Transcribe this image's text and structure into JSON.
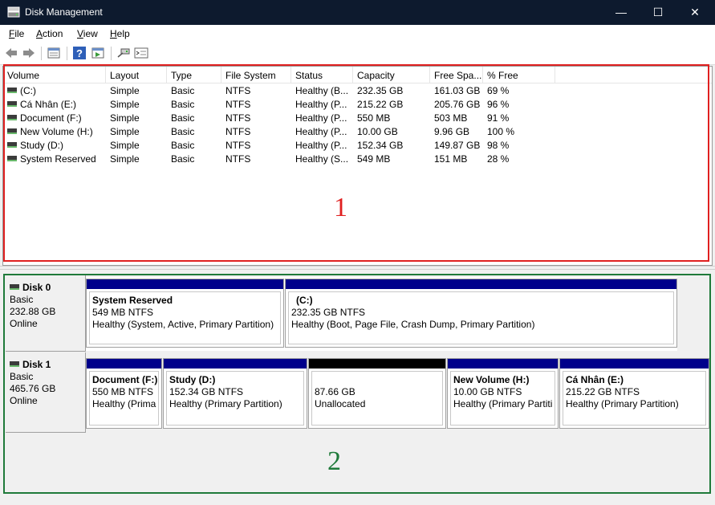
{
  "window": {
    "title": "Disk Management",
    "minimize": "—",
    "maximize": "☐",
    "close": "✕"
  },
  "menu": [
    {
      "key": "F",
      "rest": "ile"
    },
    {
      "key": "A",
      "rest": "ction"
    },
    {
      "key": "V",
      "rest": "iew"
    },
    {
      "key": "H",
      "rest": "elp"
    }
  ],
  "toolbar": {
    "icons": [
      "back-arrow-icon",
      "forward-arrow-icon",
      "properties-icon",
      "help-icon",
      "show-hide-icon",
      "connect-icon",
      "console-icon"
    ]
  },
  "volume_list": {
    "columns": [
      "Volume",
      "Layout",
      "Type",
      "File System",
      "Status",
      "Capacity",
      "Free Spa...",
      "% Free"
    ],
    "rows": [
      [
        "(C:)",
        "Simple",
        "Basic",
        "NTFS",
        "Healthy (B...",
        "232.35 GB",
        "161.03 GB",
        "69 %"
      ],
      [
        "Cá Nhân (E:)",
        "Simple",
        "Basic",
        "NTFS",
        "Healthy (P...",
        "215.22 GB",
        "205.76 GB",
        "96 %"
      ],
      [
        "Document (F:)",
        "Simple",
        "Basic",
        "NTFS",
        "Healthy (P...",
        "550 MB",
        "503 MB",
        "91 %"
      ],
      [
        "New Volume (H:)",
        "Simple",
        "Basic",
        "NTFS",
        "Healthy (P...",
        "10.00 GB",
        "9.96 GB",
        "100 %"
      ],
      [
        "Study (D:)",
        "Simple",
        "Basic",
        "NTFS",
        "Healthy (P...",
        "152.34 GB",
        "149.87 GB",
        "98 %"
      ],
      [
        "System Reserved",
        "Simple",
        "Basic",
        "NTFS",
        "Healthy (S...",
        "549 MB",
        "151 MB",
        "28 %"
      ]
    ]
  },
  "disks": [
    {
      "name": "Disk 0",
      "type": "Basic",
      "size": "232.88 GB",
      "status": "Online",
      "partitions": [
        {
          "name": "System Reserved",
          "size": "549 MB NTFS",
          "status": "Healthy (System, Active, Primary Partition)"
        },
        {
          "name": "(C:)",
          "size": "232.35 GB NTFS",
          "status": "Healthy (Boot, Page File, Crash Dump, Primary Partition)"
        }
      ]
    },
    {
      "name": "Disk 1",
      "type": "Basic",
      "size": "465.76 GB",
      "status": "Online",
      "partitions": [
        {
          "name": "Document  (F:)",
          "size": "550 MB NTFS",
          "status": "Healthy (Prima"
        },
        {
          "name": "Study  (D:)",
          "size": "152.34 GB NTFS",
          "status": "Healthy (Primary Partition)"
        },
        {
          "name": "",
          "size": "87.66 GB",
          "status": "Unallocated"
        },
        {
          "name": "New Volume  (H:)",
          "size": "10.00 GB NTFS",
          "status": "Healthy (Primary Partiti"
        },
        {
          "name": "Cá Nhân  (E:)",
          "size": "215.22 GB NTFS",
          "status": "Healthy (Primary Partition)"
        }
      ]
    }
  ],
  "annotations": {
    "label1": "1",
    "label2": "2",
    "color1": "#e02020",
    "color2": "#1f7a3a"
  }
}
